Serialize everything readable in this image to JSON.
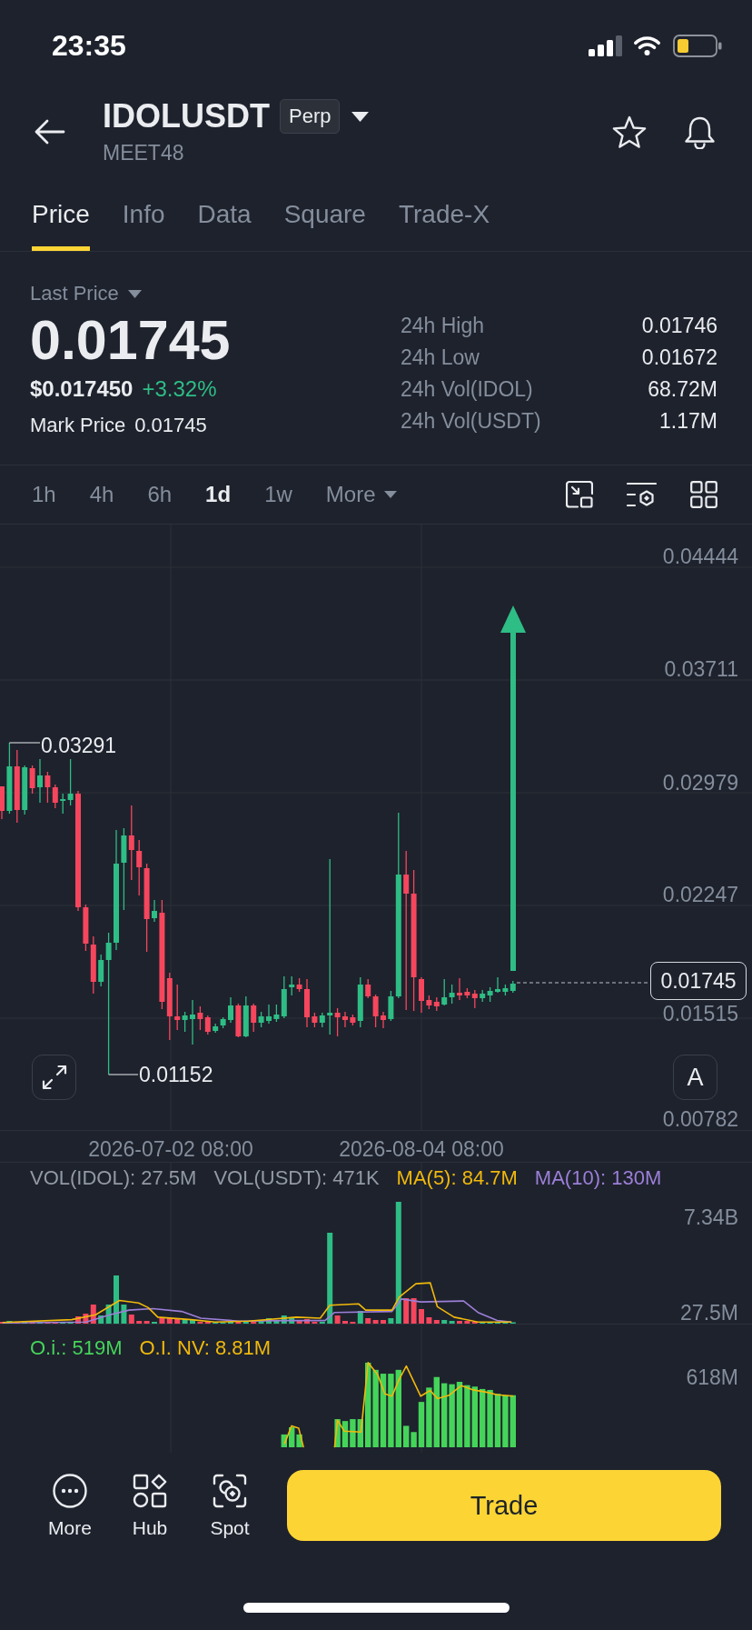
{
  "status_bar": {
    "time": "23:35"
  },
  "header": {
    "symbol": "IDOLUSDT",
    "badge": "Perp",
    "subtitle": "MEET48"
  },
  "tabs": [
    {
      "label": "Price",
      "selected": true
    },
    {
      "label": "Info",
      "selected": false
    },
    {
      "label": "Data",
      "selected": false
    },
    {
      "label": "Square",
      "selected": false
    },
    {
      "label": "Trade-X",
      "selected": false
    }
  ],
  "price_summary": {
    "price_type": "Last Price",
    "last_price": "0.01745",
    "usd_price": "$0.017450",
    "change": "+3.32%",
    "rising": true,
    "mark_price_label": "Mark Price",
    "mark_price": "0.01745"
  },
  "stats": [
    {
      "label": "24h High",
      "value": "0.01746"
    },
    {
      "label": "24h Low",
      "value": "0.01672"
    },
    {
      "label": "24h Vol(IDOL)",
      "value": "68.72M"
    },
    {
      "label": "24h Vol(USDT)",
      "value": "1.17M"
    }
  ],
  "intervals": [
    {
      "label": "1h",
      "selected": false,
      "kind": "option"
    },
    {
      "label": "4h",
      "selected": false,
      "kind": "option"
    },
    {
      "label": "6h",
      "selected": false,
      "kind": "option"
    },
    {
      "label": "1d",
      "selected": true,
      "kind": "option"
    },
    {
      "label": "1w",
      "selected": false,
      "kind": "option"
    },
    {
      "label": "More",
      "selected": false,
      "kind": "dropdown"
    }
  ],
  "price_chart": {
    "price_axis": [
      "0.04444",
      "0.03711",
      "0.02979",
      "0.02247",
      "0.01515",
      "0.00782"
    ],
    "time_axis": [
      "2026-07-02 08:00",
      "2026-08-04 08:00"
    ],
    "high_marker": "0.03291",
    "low_marker": "0.01152",
    "current_price": "0.01745",
    "auto_button": "A"
  },
  "volume_pane": {
    "legend": [
      {
        "text": "VOL(IDOL): 27.5M",
        "color": "#929aa5"
      },
      {
        "text": "VOL(USDT): 471K",
        "color": "#929aa5"
      },
      {
        "text": "MA(5): 84.7M",
        "color": "#f0b90b"
      },
      {
        "text": "MA(10): 130M",
        "color": "#9c7fd8"
      }
    ],
    "axis": [
      "7.34B",
      "27.5M"
    ]
  },
  "open_interest_pane": {
    "legend": [
      {
        "text": "O.i.: 519M",
        "color": "#45d45a"
      },
      {
        "text": "O.I. NV: 8.81M",
        "color": "#f0b90b"
      }
    ],
    "axis": [
      "618M"
    ]
  },
  "bottom_bar": {
    "actions": [
      {
        "label": "More"
      },
      {
        "label": "Hub"
      },
      {
        "label": "Spot"
      }
    ],
    "trade_button": "Trade"
  }
}
